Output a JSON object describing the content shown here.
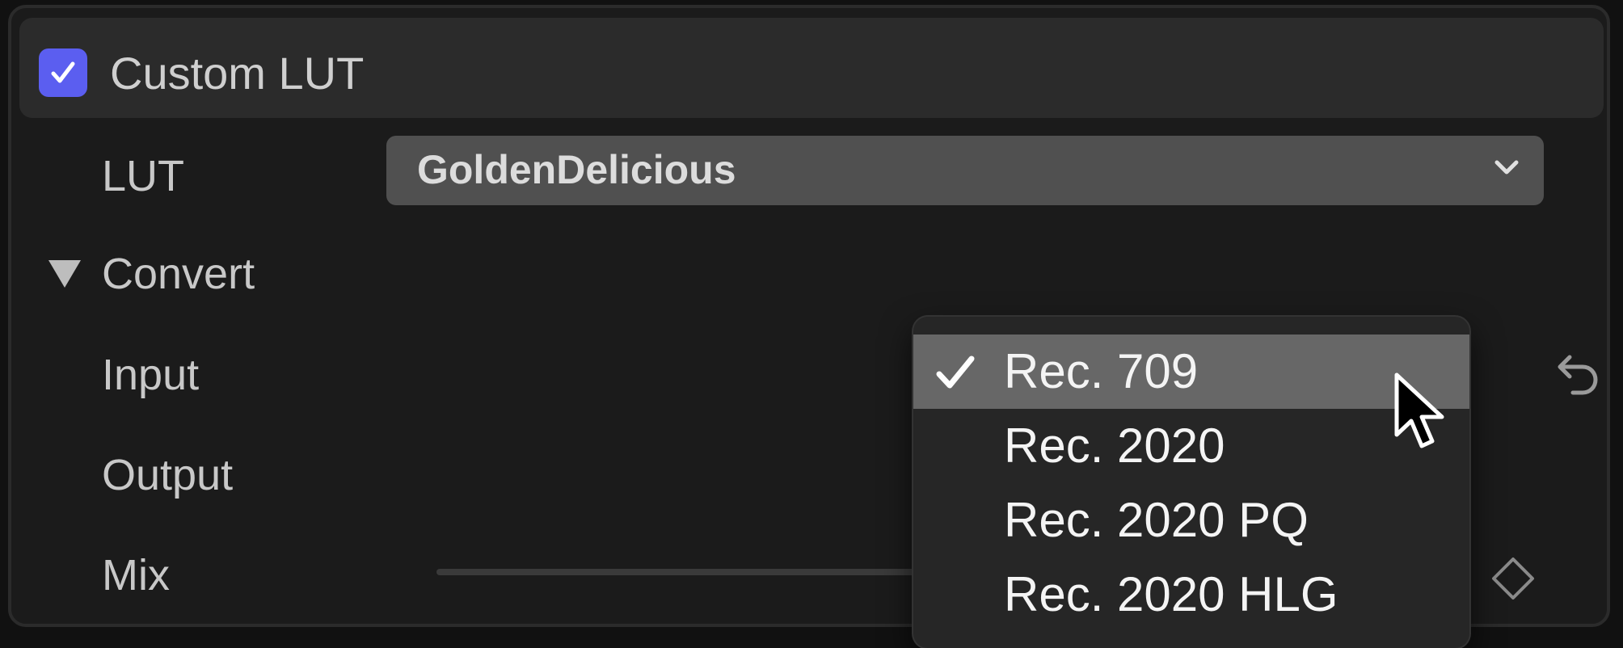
{
  "header": {
    "checkbox_checked": true,
    "title": "Custom LUT",
    "accent_color": "#5b5ef0"
  },
  "rows": {
    "lut_label": "LUT",
    "lut_value": "GoldenDelicious",
    "convert_label": "Convert",
    "input_label": "Input",
    "output_label": "Output",
    "mix_label": "Mix"
  },
  "menu": {
    "items": [
      {
        "label": "Rec. 709",
        "selected": true
      },
      {
        "label": "Rec. 2020",
        "selected": false
      },
      {
        "label": "Rec. 2020 PQ",
        "selected": false
      },
      {
        "label": "Rec. 2020 HLG",
        "selected": false
      }
    ]
  },
  "icons": {
    "checkbox": "checkmark-icon",
    "lut_dropdown": "chevron-down-icon",
    "convert_disclosure": "disclosure-triangle-down-icon",
    "reset": "undo-arrow-icon",
    "keyframe": "diamond-keyframe-icon",
    "pointer": "mouse-pointer-icon"
  }
}
